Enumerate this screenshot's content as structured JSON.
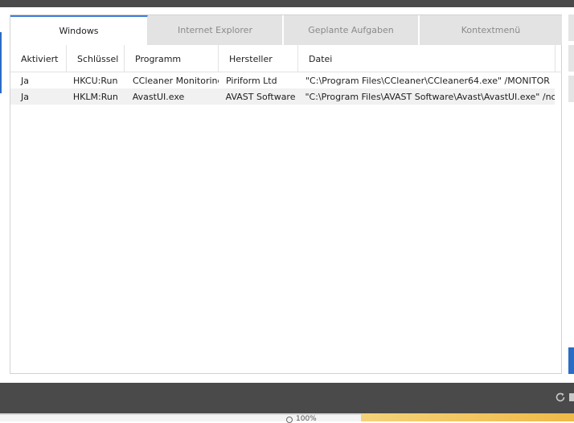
{
  "tabs": [
    {
      "label": "Windows",
      "active": true
    },
    {
      "label": "Internet Explorer",
      "active": false
    },
    {
      "label": "Geplante Aufgaben",
      "active": false
    },
    {
      "label": "Kontextmenü",
      "active": false
    }
  ],
  "table": {
    "columns": [
      "Aktiviert",
      "Schlüssel",
      "Programm",
      "Hersteller",
      "Datei"
    ],
    "rows": [
      [
        "Ja",
        "HKCU:Run",
        "CCleaner Monitoring",
        "Piriform Ltd",
        "\"C:\\Program Files\\CCleaner\\CCleaner64.exe\" /MONITOR"
      ],
      [
        "Ja",
        "HKLM:Run",
        "AvastUI.exe",
        "AVAST Software",
        "\"C:\\Program Files\\AVAST Software\\Avast\\AvastUI.exe\" /nogui"
      ]
    ]
  },
  "footer": {
    "refresh_icon": "refresh-icon"
  },
  "bottom_strip": {
    "text": "100%"
  },
  "colors": {
    "accent": "#3d7bd6",
    "footer_bg": "#4a4a4a"
  }
}
